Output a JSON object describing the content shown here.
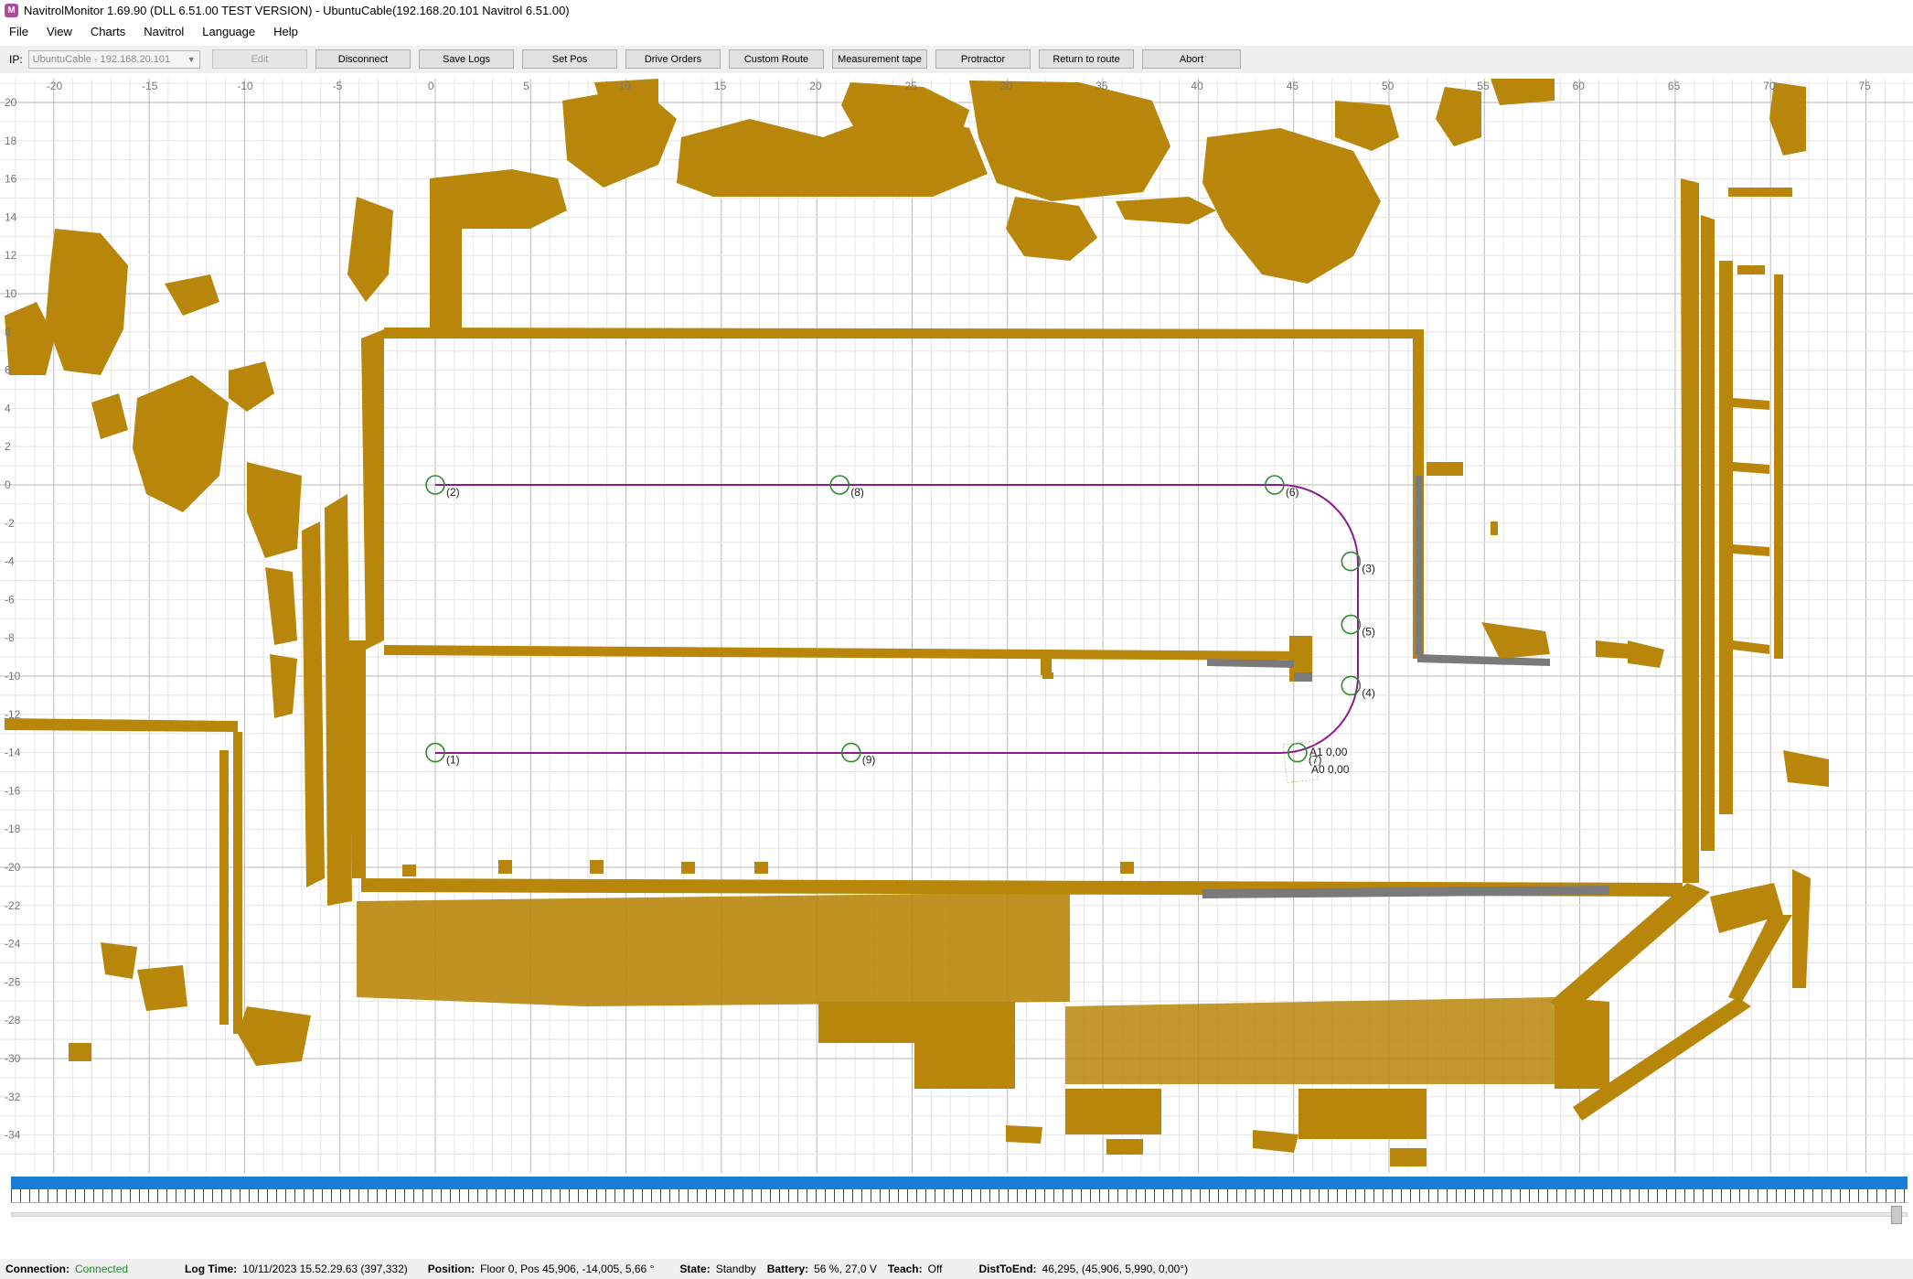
{
  "window": {
    "title": "NavitrolMonitor 1.69.90 (DLL 6.51.00 TEST VERSION) - UbuntuCable(192.168.20.101 Navitrol 6.51.00)",
    "icon": "navitrol-app-icon",
    "icon_letter": "M"
  },
  "menu": [
    "File",
    "View",
    "Charts",
    "Navitrol",
    "Language",
    "Help"
  ],
  "toolbar": {
    "ip_label": "IP:",
    "ip_value": "UbuntuCable - 192.168.20.101",
    "buttons": [
      "Edit",
      "Disconnect",
      "Save Logs",
      "Set Pos",
      "Drive Orders",
      "Custom Route",
      "Measurement tape",
      "Protractor",
      "Return to route",
      "Abort"
    ]
  },
  "map": {
    "x_ticks": [
      "-20",
      "-15",
      "-10",
      "-5",
      "0",
      "5",
      "10",
      "15",
      "20",
      "25",
      "30",
      "35",
      "40",
      "45",
      "50",
      "55",
      "60",
      "65",
      "70",
      "75"
    ],
    "y_ticks": [
      "20",
      "18",
      "16",
      "14",
      "12",
      "10",
      "8",
      "6",
      "4",
      "2",
      "0",
      "-2",
      "-4",
      "-6",
      "-8",
      "-10",
      "-12",
      "-14",
      "-16",
      "-18",
      "-20",
      "-22",
      "-24",
      "-26",
      "-28",
      "-30",
      "-32",
      "-34"
    ],
    "colors": {
      "scan": "#b8860b",
      "scan_gray": "#7a7a7a",
      "route": "#8b1a8b",
      "waypoint": "#2e8b2e",
      "grid_major": "#b8b8b8",
      "grid_minor": "#e4e4e4"
    },
    "waypoints": [
      {
        "label": "(1)",
        "x": 0,
        "y": -14
      },
      {
        "label": "(2)",
        "x": 0,
        "y": 0
      },
      {
        "label": "(3)",
        "x": 48,
        "y": -4
      },
      {
        "label": "(4)",
        "x": 48,
        "y": -10.5
      },
      {
        "label": "(5)",
        "x": 48,
        "y": -7.3
      },
      {
        "label": "(6)",
        "x": 44,
        "y": 0
      },
      {
        "label": "(7)",
        "x": 45.2,
        "y": -14
      },
      {
        "label": "(8)",
        "x": 21.2,
        "y": 0
      },
      {
        "label": "(9)",
        "x": 21.8,
        "y": -14
      }
    ],
    "vehicle_labels": [
      "A1 0,00",
      "A0 0,00"
    ]
  },
  "status": {
    "connection_label": "Connection:",
    "connection_value": "Connected",
    "logtime_label": "Log Time:",
    "logtime_value": "10/11/2023 15.52.29.63 (397,332)",
    "position_label": "Position:",
    "position_value": "Floor 0, Pos 45,906, -14,005, 5,66 °",
    "state_label": "State:",
    "state_value": "Standby",
    "battery_label": "Battery:",
    "battery_value": "56 %, 27,0 V",
    "teach_label": "Teach:",
    "teach_value": "Off",
    "dist_label": "DistToEnd:",
    "dist_value": "46,295, (45,906, 5,990, 0,00°)"
  }
}
